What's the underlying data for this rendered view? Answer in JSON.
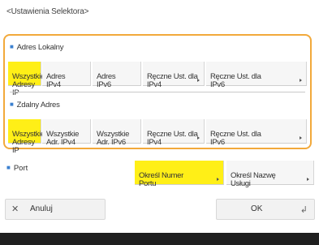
{
  "title": "<Ustawienia Selektora>",
  "local_address": {
    "label": "Adres Lokalny",
    "options": [
      {
        "label": "Wszystkie\nAdresy IP",
        "selected": true,
        "has_arrow": false
      },
      {
        "label": "Adres\nIPv4",
        "selected": false,
        "has_arrow": false
      },
      {
        "label": "Adres\nIPv6",
        "selected": false,
        "has_arrow": false
      },
      {
        "label": "Ręczne Ust. dla\nIPv4",
        "selected": false,
        "has_arrow": true
      },
      {
        "label": "Ręczne Ust. dla\nIPv6",
        "selected": false,
        "has_arrow": true
      }
    ]
  },
  "remote_address": {
    "label": "Zdalny Adres",
    "options": [
      {
        "label": "Wszystkie\nAdresy IP",
        "selected": true,
        "has_arrow": false
      },
      {
        "label": "Wszystkie\nAdr. IPv4",
        "selected": false,
        "has_arrow": false
      },
      {
        "label": "Wszystkie\nAdr. IPv6",
        "selected": false,
        "has_arrow": false
      },
      {
        "label": "Ręczne Ust. dla\nIPv4",
        "selected": false,
        "has_arrow": true
      },
      {
        "label": "Ręczne Ust. dla\nIPv6",
        "selected": false,
        "has_arrow": true
      }
    ]
  },
  "port": {
    "label": "Port",
    "options": [
      {
        "label": "Określ Numer\nPortu",
        "selected": true,
        "has_arrow": true
      },
      {
        "label": "Określ Nazwę\nUsługi",
        "selected": false,
        "has_arrow": true
      }
    ]
  },
  "buttons": {
    "cancel": "Anuluj",
    "ok": "OK"
  },
  "colors": {
    "selected": "#ffef17",
    "panel_border": "#f2a93b",
    "bullet": "#3a7fcf",
    "footer": "#1f1f1f"
  }
}
